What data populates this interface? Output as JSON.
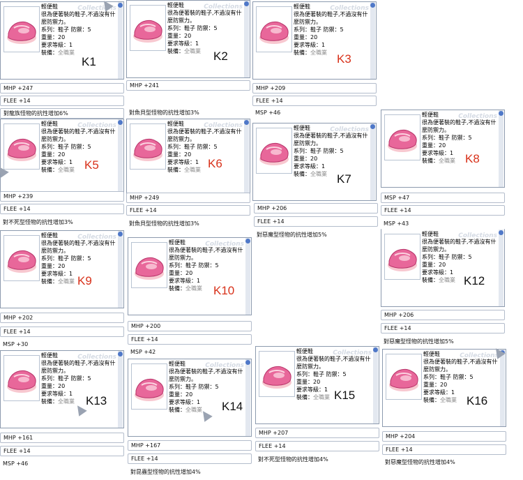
{
  "item": {
    "name": "輕便鞋",
    "desc1": "很為便著裝的鞋子,不過沒有什",
    "desc2": "麼防禦力。",
    "series": "系列：鞋子  防禦：5",
    "weight": "重量：20",
    "level": "要求等級：1",
    "equip_label": "裝備：",
    "equip_value": "全職業"
  },
  "watermark": "Collections",
  "colors": {
    "red_tag": "#d8311a",
    "black_tag": "#111111",
    "shoe": "#e8679a"
  },
  "cards": [
    {
      "tag": "K1"
    },
    {
      "tag": "K2"
    },
    {
      "tag": "K3"
    },
    {
      "tag": "K5"
    },
    {
      "tag": "K6"
    },
    {
      "tag": "K7"
    },
    {
      "tag": "K8"
    },
    {
      "tag": "K9"
    },
    {
      "tag": "K10"
    },
    {
      "tag": "K12"
    },
    {
      "tag": "K13"
    },
    {
      "tag": "K14"
    },
    {
      "tag": "K15"
    },
    {
      "tag": "K16"
    }
  ],
  "stats": {
    "k1_mhp": "MHP +247",
    "k1_flee": "FLEE +14",
    "k1_res": "對龍族怪物的抗性增加6%",
    "k2_mhp": "MHP +241",
    "k2_res": "對魚貝型怪物的抗性增加3%",
    "k3_mhp": "MHP +209",
    "k3_flee": "FLEE +14",
    "k3_msp": "MSP +46",
    "k5_mhp": "MHP +239",
    "k5_flee": "FLEE +14",
    "k5_res": "對不死型怪物的抗性增加3%",
    "k6_mhp": "MHP +249",
    "k6_flee": "FLEE +14",
    "k6_res": "對魚貝型怪物的抗性增加3%",
    "k7_mhp": "MHP +206",
    "k7_flee": "FLEE +14",
    "k7_res": "對惡魔型怪物的抗性增加5%",
    "k8_msp": "MSP +47",
    "k8_flee": "FLEE +14",
    "k8_msp2": "MSP +43",
    "k9_mhp": "MHP +202",
    "k9_flee": "FLEE +14",
    "k9_msp": "MSP +30",
    "k10_mhp": "MHP +200",
    "k10_flee": "FLEE +14",
    "k10_msp": "MSP +42",
    "k12_mhp": "MHP +206",
    "k12_flee": "FLEE +14",
    "k12_res": "對惡魔型怪物的抗性增加5%",
    "k13_mhp": "MHP +161",
    "k13_flee": "FLEE +14",
    "k13_msp": "MSP +46",
    "k14_mhp": "MHP +167",
    "k14_flee": "FLEE +14",
    "k14_res": "對昆蟲型怪物的抗性增加4%",
    "k15_mhp": "MHP +207",
    "k15_flee": "FLEE +14",
    "k15_res": "對不死型怪物的抗性增加4%",
    "k16_mhp": "MHP +204",
    "k16_flee": "FLEE +14",
    "k16_res": "對惡魔型怪物的抗性增加4%"
  }
}
